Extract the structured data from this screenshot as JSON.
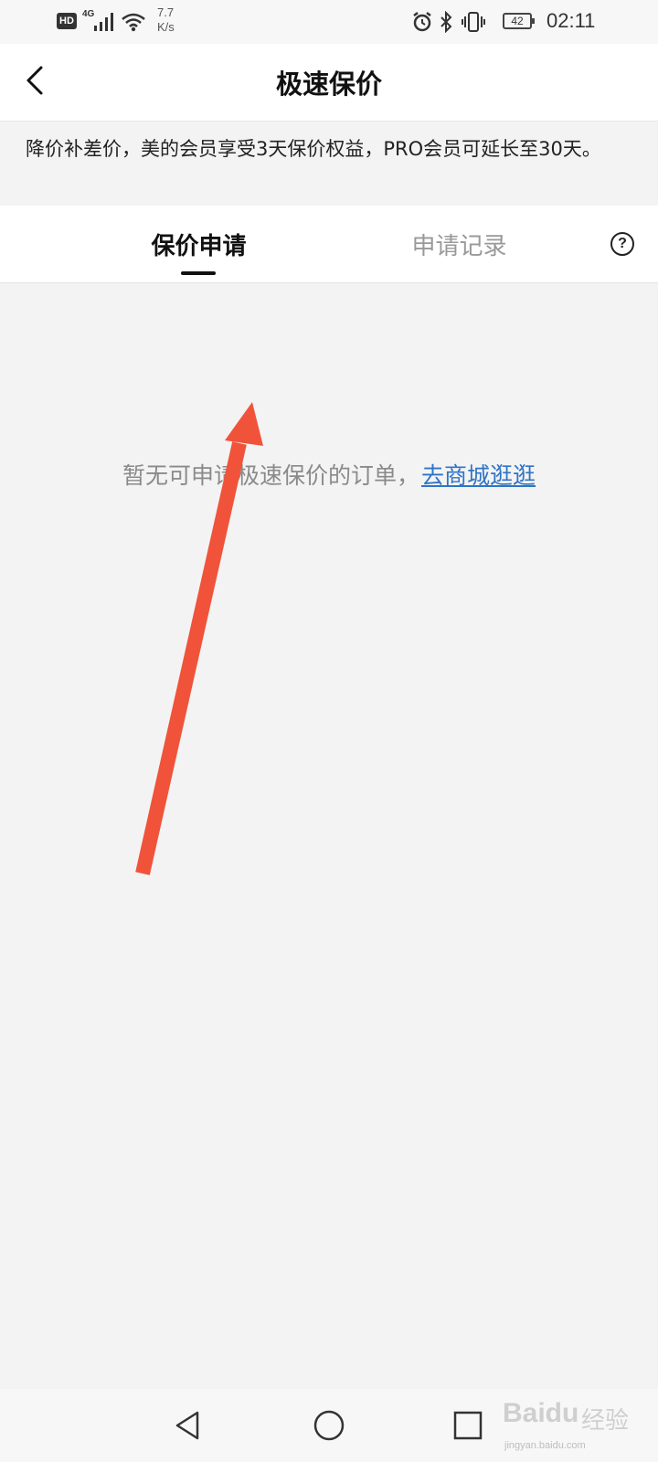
{
  "status_bar": {
    "hd": "HD",
    "network": "4G",
    "speed_value": "7.7",
    "speed_unit": "K/s",
    "battery": "42",
    "time": "02:11",
    "icons": [
      "signal-icon",
      "wifi-icon",
      "alarm-icon",
      "bluetooth-icon",
      "vibrate-icon",
      "battery-icon"
    ]
  },
  "header": {
    "title": "极速保价",
    "back_icon": "chevron-left-icon"
  },
  "notice": {
    "text": "降价补差价，美的会员享受3天保价权益，PRO会员可延长至30天。"
  },
  "tabs": [
    {
      "label": "保价申请",
      "active": true
    },
    {
      "label": "申请记录",
      "active": false
    }
  ],
  "help": {
    "label": "?"
  },
  "empty_state": {
    "message": "暂无可申请极速保价的订单，",
    "link": "去商城逛逛"
  },
  "annotation": {
    "color": "#f0533a"
  },
  "nav_bar": {
    "buttons": [
      "back-triangle-icon",
      "home-circle-icon",
      "recents-square-icon"
    ]
  },
  "watermark": {
    "brand": "Baidu",
    "label": "经验",
    "url": "jingyan.baidu.com"
  }
}
